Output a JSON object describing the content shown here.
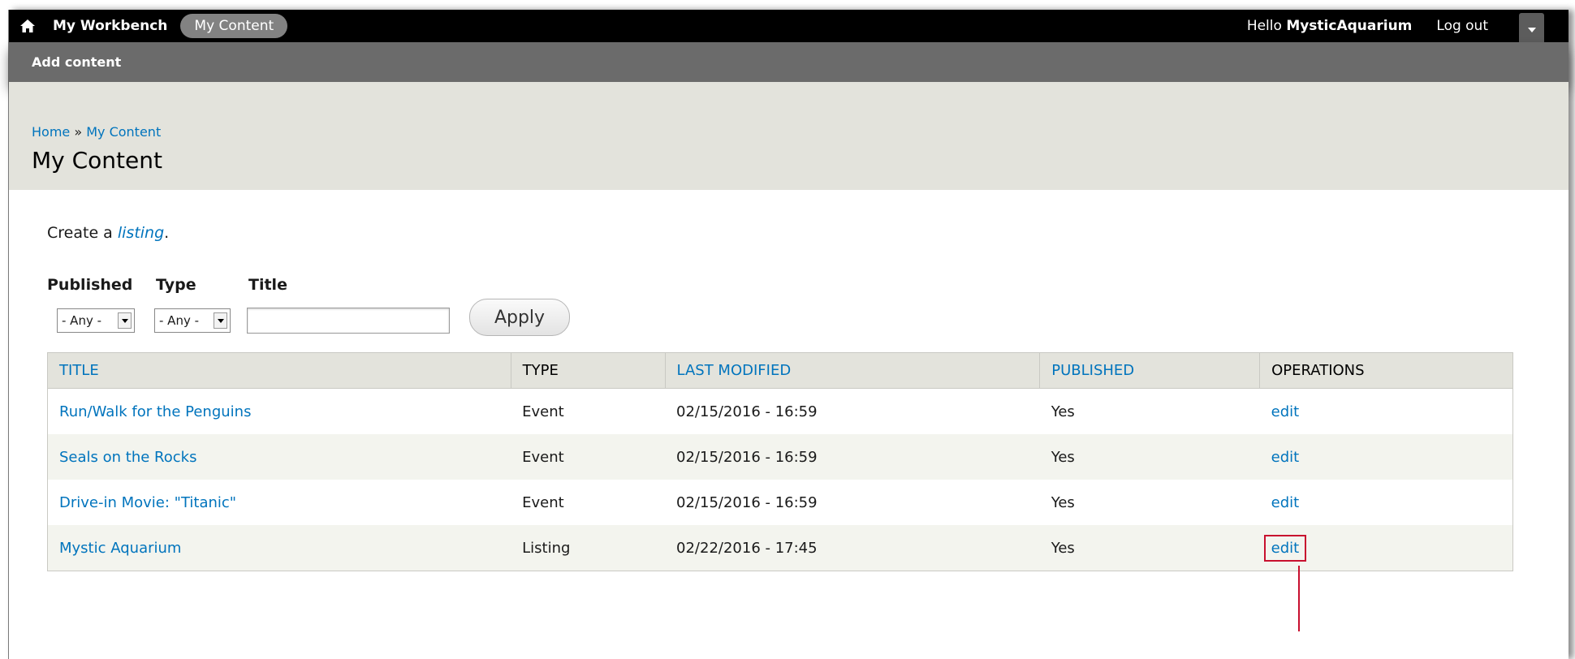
{
  "toolbar": {
    "workbench": "My Workbench",
    "my_content": "My Content",
    "hello_prefix": "Hello ",
    "username": "MysticAquarium",
    "logout": "Log out"
  },
  "shortcuts": {
    "add_content": "Add content"
  },
  "breadcrumb": {
    "home": "Home",
    "separator": " » ",
    "current": "My Content"
  },
  "page_title": "My Content",
  "create": {
    "prefix": "Create a ",
    "link": "listing",
    "suffix": "."
  },
  "filters": {
    "published_label": "Published",
    "published_value": "- Any -",
    "type_label": "Type",
    "type_value": "- Any -",
    "title_label": "Title",
    "title_value": "",
    "apply_label": "Apply"
  },
  "table": {
    "columns": [
      "TITLE",
      "TYPE",
      "LAST MODIFIED",
      "PUBLISHED",
      "OPERATIONS"
    ],
    "rows": [
      {
        "title": "Run/Walk for the Penguins",
        "type": "Event",
        "modified": "02/15/2016 - 16:59",
        "published": "Yes",
        "op": "edit"
      },
      {
        "title": "Seals on the Rocks",
        "type": "Event",
        "modified": "02/15/2016 - 16:59",
        "published": "Yes",
        "op": "edit"
      },
      {
        "title": "Drive-in Movie: \"Titanic\"",
        "type": "Event",
        "modified": "02/15/2016 - 16:59",
        "published": "Yes",
        "op": "edit"
      },
      {
        "title": "Mystic Aquarium",
        "type": "Listing",
        "modified": "02/22/2016 - 17:45",
        "published": "Yes",
        "op": "edit"
      }
    ]
  },
  "colors": {
    "link": "#0074bd",
    "header_bg": "#e3e3dc",
    "highlight": "#c8102e"
  }
}
